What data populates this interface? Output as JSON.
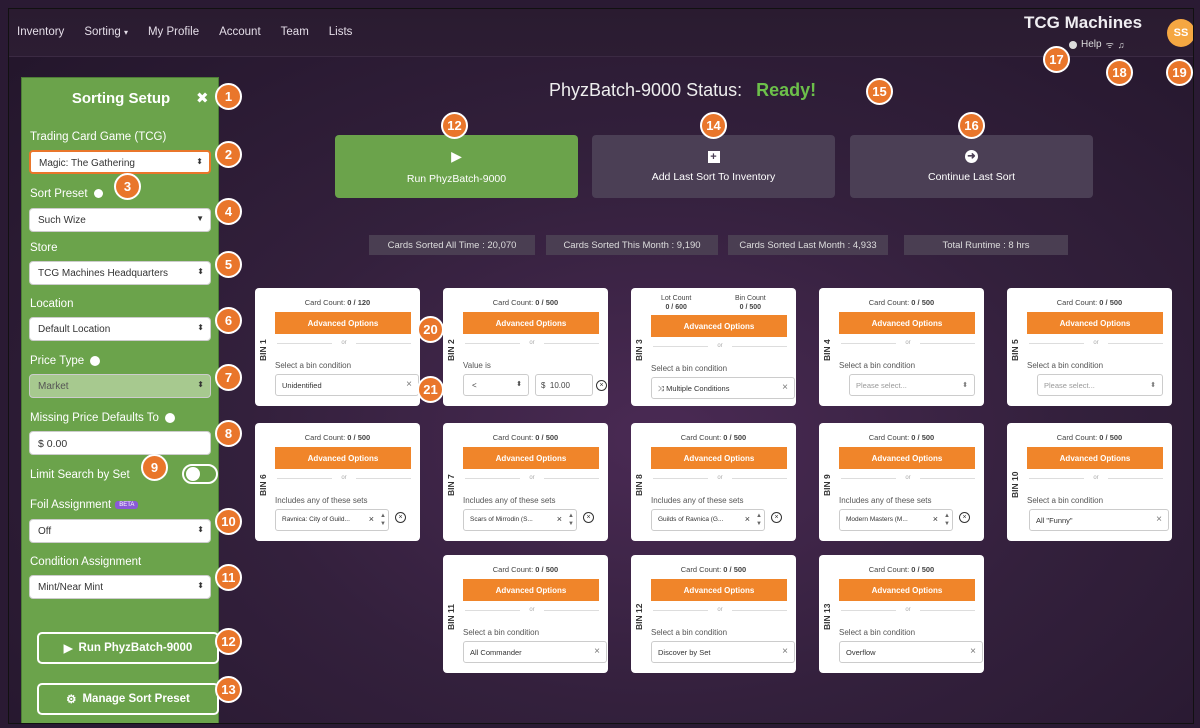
{
  "nav": {
    "items": [
      "Inventory",
      "Sorting",
      "My Profile",
      "Account",
      "Team",
      "Lists"
    ],
    "sorting_caret": "▾"
  },
  "brand": "TCG Machines",
  "help": "Help",
  "avatar": "SS",
  "sidebar": {
    "title": "Sorting Setup",
    "tcg_label": "Trading Card Game (TCG)",
    "tcg_value": "Magic: The Gathering",
    "preset_label": "Sort Preset",
    "preset_value": "Such Wize",
    "store_label": "Store",
    "store_value": "TCG Machines Headquarters",
    "location_label": "Location",
    "location_value": "Default Location",
    "price_type_label": "Price Type",
    "price_type_value": "Market",
    "missing_price_label": "Missing Price Defaults To",
    "missing_price_value": "$ 0.00",
    "limit_search_label": "Limit Search by Set",
    "foil_label": "Foil Assignment",
    "foil_badge": "BETA",
    "foil_value": "Off",
    "condition_label": "Condition Assignment",
    "condition_value": "Mint/Near Mint",
    "run_label": "Run PhyzBatch-9000",
    "manage_label": "Manage Sort Preset"
  },
  "status": {
    "label": "PhyzBatch-9000 Status:",
    "value": "Ready!"
  },
  "actions": {
    "run": "Run PhyzBatch-9000",
    "add": "Add Last Sort To Inventory",
    "continue": "Continue Last Sort"
  },
  "stats": [
    "Cards Sorted All Time : 20,070",
    "Cards Sorted This Month : 9,190",
    "Cards Sorted Last Month : 4,933",
    "Total Runtime : 8 hrs"
  ],
  "bins": {
    "adv": "Advanced Options",
    "or": "or",
    "b1": {
      "name": "BIN 1",
      "count_label": "Card Count:",
      "count": "0 / 120",
      "cond": "Select a bin condition",
      "value": "Unidentified"
    },
    "b2": {
      "name": "BIN 2",
      "count_label": "Card Count:",
      "count": "0 / 500",
      "cond": "Value is",
      "op": "<",
      "dollar": "$",
      "amount": "10.00"
    },
    "b3": {
      "name": "BIN 3",
      "lot_label": "Lot Count",
      "lot": "0 / 600",
      "bin_label": "Bin Count",
      "bincount": "0 / 500",
      "cond": "Select a bin condition",
      "value": "Multiple Conditions"
    },
    "b4": {
      "name": "BIN 4",
      "count_label": "Card Count:",
      "count": "0 / 500",
      "cond": "Select a bin condition",
      "value": "Please select..."
    },
    "b5": {
      "name": "BIN 5",
      "count_label": "Card Count:",
      "count": "0 / 500",
      "cond": "Select a bin condition",
      "value": "Please select..."
    },
    "b6": {
      "name": "BIN 6",
      "count_label": "Card Count:",
      "count": "0 / 500",
      "cond": "Includes any of these sets",
      "value": "Ravnica: City of Guild..."
    },
    "b7": {
      "name": "BIN 7",
      "count_label": "Card Count:",
      "count": "0 / 500",
      "cond": "Includes any of these sets",
      "value": "Scars of Mirrodin (S..."
    },
    "b8": {
      "name": "BIN 8",
      "count_label": "Card Count:",
      "count": "0 / 500",
      "cond": "Includes any of these sets",
      "value": "Guilds of Ravnica (G..."
    },
    "b9": {
      "name": "BIN 9",
      "count_label": "Card Count:",
      "count": "0 / 500",
      "cond": "Includes any of these sets",
      "value": "Modern Masters (M..."
    },
    "b10": {
      "name": "BIN 10",
      "count_label": "Card Count:",
      "count": "0 / 500",
      "cond": "Select a bin condition",
      "value": "All \"Funny\""
    },
    "b11": {
      "name": "BIN 11",
      "count_label": "Card Count:",
      "count": "0 / 500",
      "cond": "Select a bin condition",
      "value": "All Commander"
    },
    "b12": {
      "name": "BIN 12",
      "count_label": "Card Count:",
      "count": "0 / 500",
      "cond": "Select a bin condition",
      "value": "Discover by Set"
    },
    "b13": {
      "name": "BIN 13",
      "count_label": "Card Count:",
      "count": "0 / 500",
      "cond": "Select a bin condition",
      "value": "Overflow"
    }
  },
  "badges": [
    "1",
    "2",
    "3",
    "4",
    "5",
    "6",
    "7",
    "8",
    "9",
    "10",
    "11",
    "12",
    "13",
    "12",
    "14",
    "15",
    "16",
    "17",
    "18",
    "19",
    "20",
    "21"
  ],
  "colors": {
    "accent_orange": "#f0852a",
    "sidebar_green": "#6ba34b",
    "ready_green": "#6cc04a",
    "badge_orange": "#e9762b"
  }
}
